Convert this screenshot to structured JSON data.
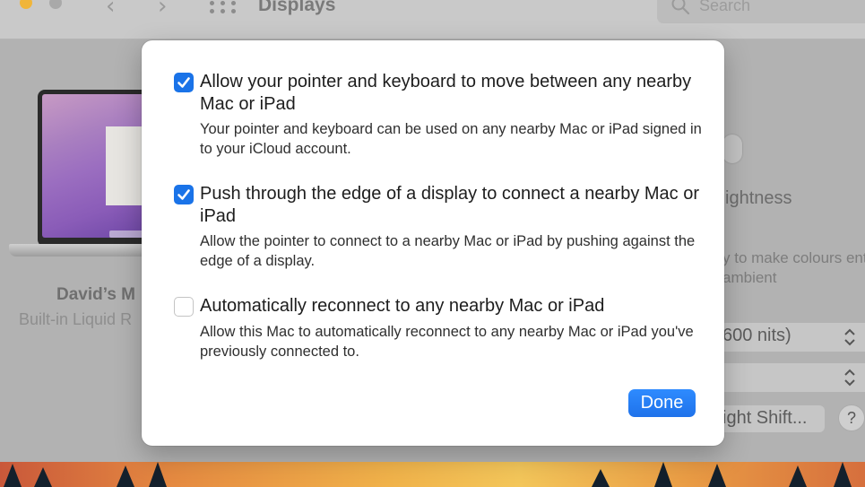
{
  "window": {
    "title": "Displays",
    "search_placeholder": "Search",
    "nav_back_icon": "chevron-left-icon",
    "nav_forward_icon": "chevron-right-icon",
    "grid_icon": "show-all-grid-icon"
  },
  "background": {
    "device_name": "David’s M",
    "device_subtitle": "Built-in Liquid R",
    "brightness_label": "ightness",
    "auto_brightness_desc": "y to make colours ent ambient",
    "preset_value": "600 nits)",
    "night_shift_label": "ight Shift...",
    "help_label": "?"
  },
  "dialog": {
    "options": [
      {
        "title": "Allow your pointer and keyboard to move between any nearby Mac or iPad",
        "description": "Your pointer and keyboard can be used on any nearby Mac or iPad signed in to your iCloud account.",
        "checked": true
      },
      {
        "title": "Push through the edge of a display to connect a nearby Mac or iPad",
        "description": "Allow the pointer to connect to a nearby Mac or iPad by pushing against the edge of a display.",
        "checked": true
      },
      {
        "title": "Automatically reconnect to any nearby Mac or iPad",
        "description": "Allow this Mac to automatically reconnect to any nearby Mac or iPad you've previously connected to.",
        "checked": false
      }
    ],
    "done_label": "Done"
  },
  "colors": {
    "accent": "#1a73e8",
    "sheet_background": "#ffffff",
    "window_background": "#b2b2b2"
  }
}
